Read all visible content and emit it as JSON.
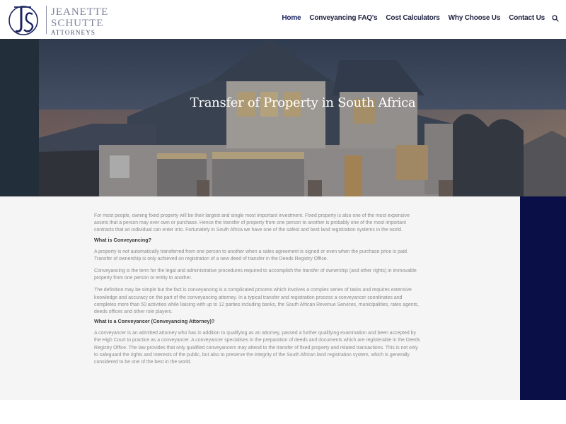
{
  "header": {
    "logo": {
      "line1": "JEANETTE",
      "line2": "SCHUTTE",
      "line3": "ATTORNEYS"
    },
    "nav": [
      {
        "label": "Home",
        "active": true
      },
      {
        "label": "Conveyancing FAQ's",
        "active": false
      },
      {
        "label": "Cost Calculators",
        "active": false
      },
      {
        "label": "Why Choose Us",
        "active": false
      },
      {
        "label": "Contact Us",
        "active": false
      }
    ],
    "search_icon": "search-icon"
  },
  "hero": {
    "title": "Transfer of Property in South Africa"
  },
  "article": {
    "p1": "For most people, owning fixed property will be their largest and single most important investment. Fixed property is also one of the most expensive assets that a person may ever own or purchase. Hence the transfer of property from one person to another is probably one of the most important contracts that an individual can enter into. Fortunately in South Africa we have one of the safest and best land registration systems in the world.",
    "h1": "What is Conveyancing?",
    "p2": "A property is not automatically transferred from one person to another when a sales agreement is signed or even when the purchase price is paid. Transfer of ownership is only achieved on registration of a new deed of transfer in the Deeds Registry Office.",
    "p3": "Conveyancing is the term for the legal and administrative procedures required to accomplish the transfer of ownership (and other rights) in immovable property from one person or entity to another.",
    "p4": "The definition may be simple but the fact is conveyancing is a complicated process which involves a complex series of tasks and requires extensive knowledge and accuracy on the part of the conveyancing attorney. In a typical transfer and registration process a conveyancer coordinates and completes more than 50 activities while liaising with up to 12 parties including banks, the South African Revenue Services, municipalities, rates agents, deeds offices and other role players.",
    "h2": "What is a Conveyancer (Conveyancing Attorney)?",
    "p5": "A conveyancer is an admitted attorney who has in addition to qualifying as an attorney, passed a further qualifying examination and been accepted by the High Court to practice as a conveyancer. A conveyancer specialises in the preparation of deeds and documents which are registerable in the Deeds Registry Office. The law provides that only qualified conveyancers may attend to the transfer of fixed property and related transactions. This is not only to safeguard the rights and interests of the public, but also to preserve the integrity of the South African land registration system, which is generally considered to be one of the best in the world."
  },
  "colors": {
    "navy": "#0a0f47",
    "nav_text": "#1e2140",
    "body_text": "#8c8c8c",
    "heading_text": "#3b3b3b",
    "content_bg": "#f5f5f5"
  }
}
